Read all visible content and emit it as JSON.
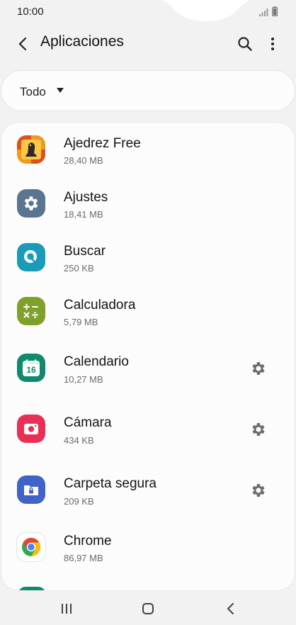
{
  "status": {
    "time": "10:00"
  },
  "header": {
    "title": "Aplicaciones"
  },
  "filter": {
    "label": "Todo"
  },
  "apps": [
    {
      "name": "Ajedrez Free",
      "size": "28,40 MB",
      "icon": "chess-icon",
      "gear": false
    },
    {
      "name": "Ajustes",
      "size": "18,41 MB",
      "icon": "settings-app-icon",
      "gear": false
    },
    {
      "name": "Buscar",
      "size": "250 KB",
      "icon": "finder-app-icon",
      "gear": false
    },
    {
      "name": "Calculadora",
      "size": "5,79 MB",
      "icon": "calculator-app-icon",
      "gear": false
    },
    {
      "name": "Calendario",
      "size": "10,27 MB",
      "icon": "calendar-app-icon",
      "gear": true,
      "icon_text": "16"
    },
    {
      "name": "Cámara",
      "size": "434 KB",
      "icon": "camera-app-icon",
      "gear": true
    },
    {
      "name": "Carpeta segura",
      "size": "209 KB",
      "icon": "secure-folder-app-icon",
      "gear": true
    },
    {
      "name": "Chrome",
      "size": "86,97 MB",
      "icon": "chrome-app-icon",
      "gear": false
    }
  ],
  "colors": {
    "settings": "#5a7590",
    "finder": "#1a9bb8",
    "calculator": "#7fa12c",
    "calendar": "#0f8a6e",
    "camera": "#ea2f55",
    "secure_folder": "#3f63c8",
    "gear": "#6d6d6d"
  }
}
